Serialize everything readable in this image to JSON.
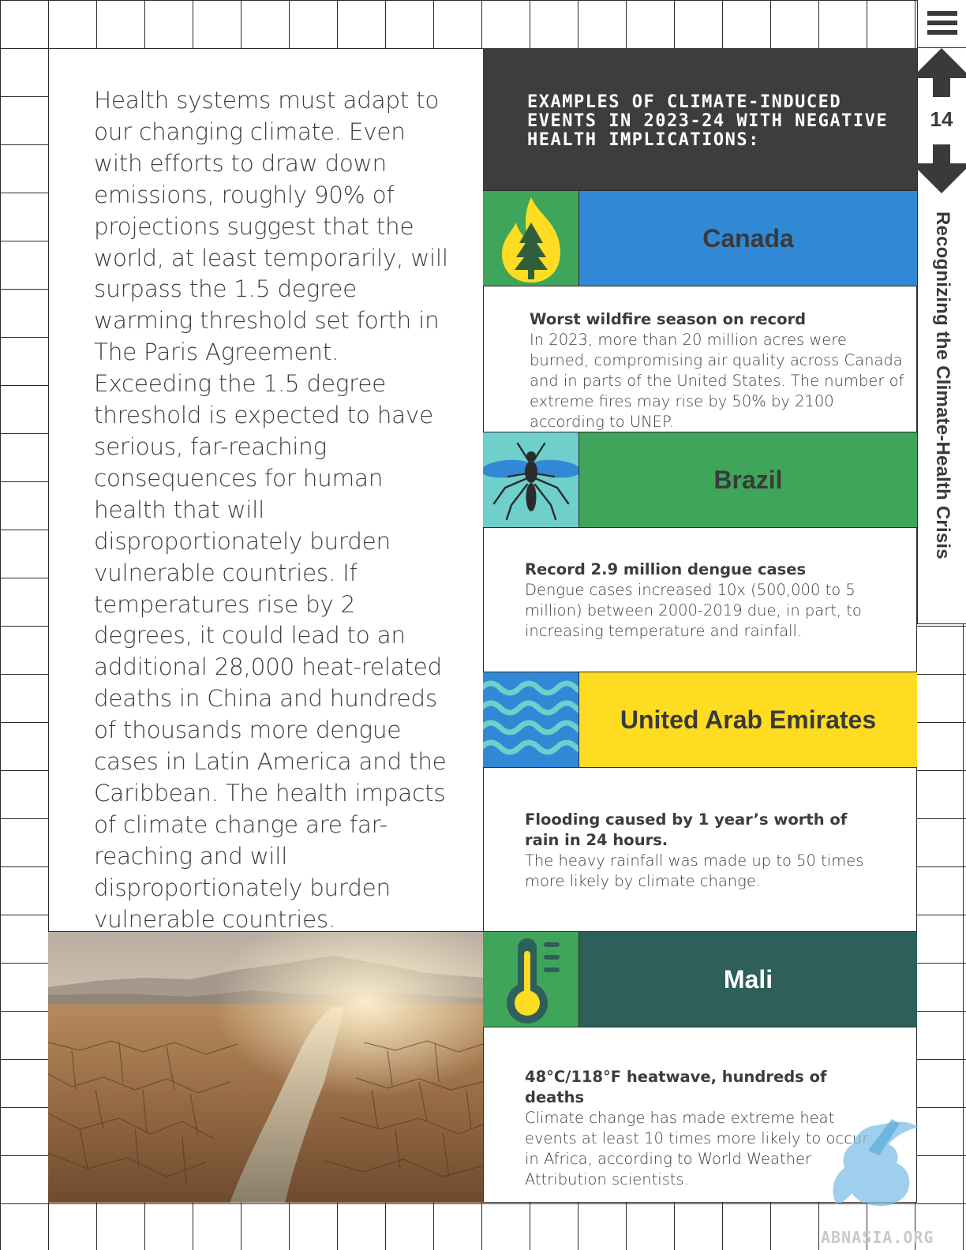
{
  "page": {
    "number": "14",
    "section_title": "Recognizing the Climate-Health Crisis"
  },
  "intro": {
    "text": "Health systems must adapt to our changing climate. Even with efforts to draw down emissions, roughly 90% of projections suggest that the world, at least temporarily, will surpass the 1.5 degree warming threshold set forth in The Paris Agreement. Exceeding the 1.5 degree threshold is expected to have serious, far-reaching consequences for human health that will disproportionately burden vulnerable countries. If temperatures rise by 2 degrees, it could lead to an additional 28,000 heat-related deaths in China and hundreds of thousands more dengue cases in Latin America and the Caribbean. The health impacts of climate change are far-reaching and will disproportionately burden vulnerable countries."
  },
  "header": {
    "title": "EXAMPLES OF CLIMATE-INDUCED EVENTS IN 2023-24 WITH NEGATIVE HEALTH IMPLICATIONS:"
  },
  "examples": [
    {
      "country": "Canada",
      "icon": "wildfire-icon",
      "color": "#3189d6",
      "icon_bg": "#3fa55b",
      "title": "Worst wildfire season on record",
      "body": "In 2023, more than 20 million acres were burned, compromising air quality across Canada and in parts of the United States. The number of extreme fires may rise by 50% by 2100 according to UNEP."
    },
    {
      "country": "Brazil",
      "icon": "mosquito-icon",
      "color": "#3fa55b",
      "icon_bg": "#6fcfca",
      "title": "Record 2.9 million dengue cases",
      "body": "Dengue cases increased 10x (500,000 to 5 million) between 2000-2019 due, in part, to increasing temperature and rainfall."
    },
    {
      "country": "United Arab Emirates",
      "icon": "waves-icon",
      "color": "#fddc22",
      "icon_bg": "#3189d6",
      "title": "Flooding caused by 1 year’s worth of rain in 24 hours.",
      "body": "The heavy rainfall was made up to 50 times more likely by climate change."
    },
    {
      "country": "Mali",
      "icon": "thermometer-icon",
      "color": "#2e5f5a",
      "icon_bg": "#3fa55b",
      "title": "48°C/118°F heatwave, hundreds of deaths",
      "body": "Climate change has made extreme heat events at least 10 times more likely to occur in Africa, according to World Weather Attribution scientists."
    }
  ],
  "watermark": {
    "text": "ABNASIA.ORG"
  }
}
